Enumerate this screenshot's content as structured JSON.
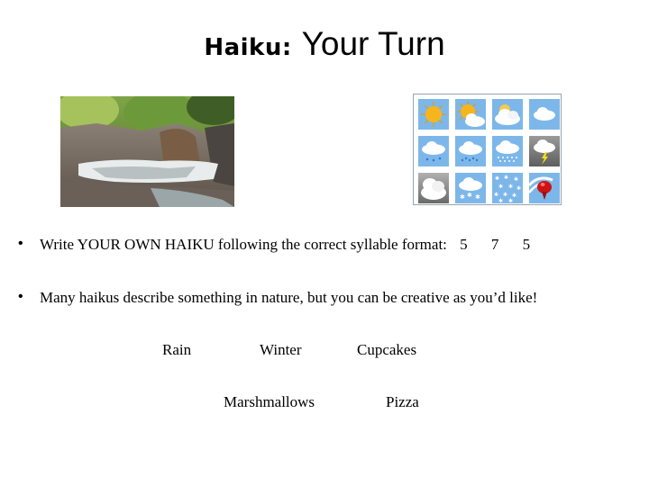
{
  "title": {
    "bold_part": "Haiku:",
    "normal_part": "Your Turn"
  },
  "images": {
    "photo": "waterfall-photo",
    "weather_grid": {
      "name": "weather-icons-grid",
      "icons": [
        "sunny-icon",
        "partly-sunny-icon",
        "mostly-cloudy-icon",
        "cloudy-icon",
        "light-rain-icon",
        "rain-icon",
        "heavy-rain-icon",
        "thunderstorm-icon",
        "overcast-icon",
        "snow-showers-icon",
        "snow-icon",
        "windy-icon"
      ]
    }
  },
  "bullets": [
    {
      "text": "Write YOUR OWN HAIKU following the correct syllable format:",
      "syllables": [
        "5",
        "7",
        "5"
      ]
    },
    {
      "text": "Many haikus describe something in nature, but you can be creative as you’d like!"
    }
  ],
  "bullet_glyph": "•",
  "topics": {
    "row1": [
      "Rain",
      "Winter",
      "Cupcakes"
    ],
    "row2": [
      "Marshmallows",
      "Pizza"
    ]
  }
}
